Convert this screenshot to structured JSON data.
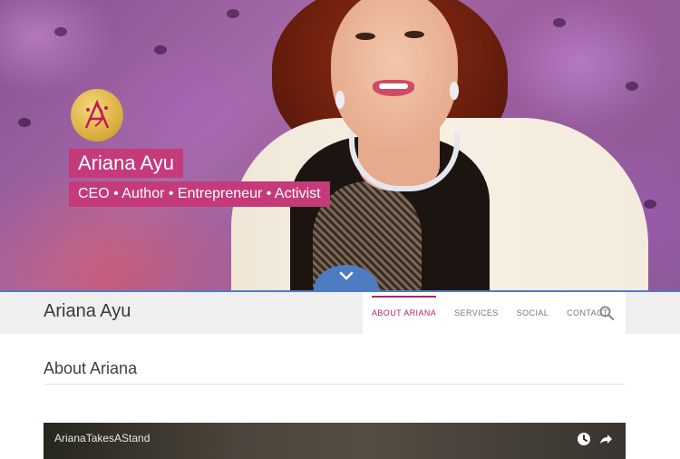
{
  "hero": {
    "name": "Ariana Ayu",
    "tagline": "CEO • Author • Entrepreneur • Activist",
    "logo_icon": "ariana-monogram-logo",
    "scroll_icon": "chevron-down-icon"
  },
  "nav": {
    "brand": "Ariana Ayu",
    "items": [
      {
        "label": "ABOUT ARIANA",
        "active": true
      },
      {
        "label": "SERVICES",
        "active": false
      },
      {
        "label": "SOCIAL",
        "active": false
      },
      {
        "label": "CONTACT",
        "active": false
      }
    ],
    "search_icon": "search-icon"
  },
  "main": {
    "section_title": "About Ariana",
    "video": {
      "title": "ArianaTakesAStand",
      "icons": [
        "clock-icon",
        "share-icon"
      ]
    }
  },
  "colors": {
    "accent": "#c43a7a",
    "nav_active": "#b4246a",
    "scroll_button": "#4e7cc2"
  }
}
